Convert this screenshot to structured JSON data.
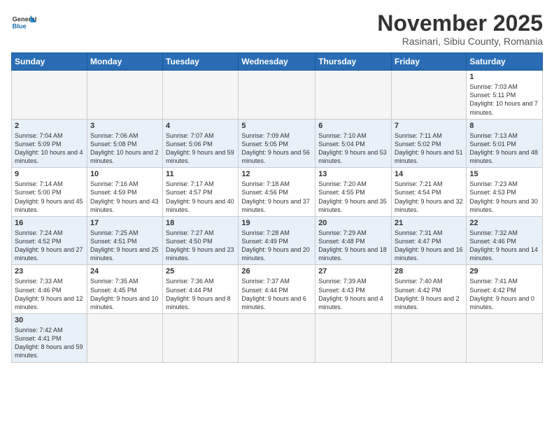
{
  "header": {
    "logo_general": "General",
    "logo_blue": "Blue",
    "month_title": "November 2025",
    "subtitle": "Rasinari, Sibiu County, Romania"
  },
  "days_of_week": [
    "Sunday",
    "Monday",
    "Tuesday",
    "Wednesday",
    "Thursday",
    "Friday",
    "Saturday"
  ],
  "weeks": [
    {
      "days": [
        {
          "num": "",
          "info": ""
        },
        {
          "num": "",
          "info": ""
        },
        {
          "num": "",
          "info": ""
        },
        {
          "num": "",
          "info": ""
        },
        {
          "num": "",
          "info": ""
        },
        {
          "num": "",
          "info": ""
        },
        {
          "num": "1",
          "info": "Sunrise: 7:03 AM\nSunset: 5:11 PM\nDaylight: 10 hours and 7 minutes."
        }
      ]
    },
    {
      "days": [
        {
          "num": "2",
          "info": "Sunrise: 7:04 AM\nSunset: 5:09 PM\nDaylight: 10 hours and 4 minutes."
        },
        {
          "num": "3",
          "info": "Sunrise: 7:06 AM\nSunset: 5:08 PM\nDaylight: 10 hours and 2 minutes."
        },
        {
          "num": "4",
          "info": "Sunrise: 7:07 AM\nSunset: 5:06 PM\nDaylight: 9 hours and 59 minutes."
        },
        {
          "num": "5",
          "info": "Sunrise: 7:09 AM\nSunset: 5:05 PM\nDaylight: 9 hours and 56 minutes."
        },
        {
          "num": "6",
          "info": "Sunrise: 7:10 AM\nSunset: 5:04 PM\nDaylight: 9 hours and 53 minutes."
        },
        {
          "num": "7",
          "info": "Sunrise: 7:11 AM\nSunset: 5:02 PM\nDaylight: 9 hours and 51 minutes."
        },
        {
          "num": "8",
          "info": "Sunrise: 7:13 AM\nSunset: 5:01 PM\nDaylight: 9 hours and 48 minutes."
        }
      ]
    },
    {
      "days": [
        {
          "num": "9",
          "info": "Sunrise: 7:14 AM\nSunset: 5:00 PM\nDaylight: 9 hours and 45 minutes."
        },
        {
          "num": "10",
          "info": "Sunrise: 7:16 AM\nSunset: 4:59 PM\nDaylight: 9 hours and 43 minutes."
        },
        {
          "num": "11",
          "info": "Sunrise: 7:17 AM\nSunset: 4:57 PM\nDaylight: 9 hours and 40 minutes."
        },
        {
          "num": "12",
          "info": "Sunrise: 7:18 AM\nSunset: 4:56 PM\nDaylight: 9 hours and 37 minutes."
        },
        {
          "num": "13",
          "info": "Sunrise: 7:20 AM\nSunset: 4:55 PM\nDaylight: 9 hours and 35 minutes."
        },
        {
          "num": "14",
          "info": "Sunrise: 7:21 AM\nSunset: 4:54 PM\nDaylight: 9 hours and 32 minutes."
        },
        {
          "num": "15",
          "info": "Sunrise: 7:23 AM\nSunset: 4:53 PM\nDaylight: 9 hours and 30 minutes."
        }
      ]
    },
    {
      "days": [
        {
          "num": "16",
          "info": "Sunrise: 7:24 AM\nSunset: 4:52 PM\nDaylight: 9 hours and 27 minutes."
        },
        {
          "num": "17",
          "info": "Sunrise: 7:25 AM\nSunset: 4:51 PM\nDaylight: 9 hours and 25 minutes."
        },
        {
          "num": "18",
          "info": "Sunrise: 7:27 AM\nSunset: 4:50 PM\nDaylight: 9 hours and 23 minutes."
        },
        {
          "num": "19",
          "info": "Sunrise: 7:28 AM\nSunset: 4:49 PM\nDaylight: 9 hours and 20 minutes."
        },
        {
          "num": "20",
          "info": "Sunrise: 7:29 AM\nSunset: 4:48 PM\nDaylight: 9 hours and 18 minutes."
        },
        {
          "num": "21",
          "info": "Sunrise: 7:31 AM\nSunset: 4:47 PM\nDaylight: 9 hours and 16 minutes."
        },
        {
          "num": "22",
          "info": "Sunrise: 7:32 AM\nSunset: 4:46 PM\nDaylight: 9 hours and 14 minutes."
        }
      ]
    },
    {
      "days": [
        {
          "num": "23",
          "info": "Sunrise: 7:33 AM\nSunset: 4:46 PM\nDaylight: 9 hours and 12 minutes."
        },
        {
          "num": "24",
          "info": "Sunrise: 7:35 AM\nSunset: 4:45 PM\nDaylight: 9 hours and 10 minutes."
        },
        {
          "num": "25",
          "info": "Sunrise: 7:36 AM\nSunset: 4:44 PM\nDaylight: 9 hours and 8 minutes."
        },
        {
          "num": "26",
          "info": "Sunrise: 7:37 AM\nSunset: 4:44 PM\nDaylight: 9 hours and 6 minutes."
        },
        {
          "num": "27",
          "info": "Sunrise: 7:39 AM\nSunset: 4:43 PM\nDaylight: 9 hours and 4 minutes."
        },
        {
          "num": "28",
          "info": "Sunrise: 7:40 AM\nSunset: 4:42 PM\nDaylight: 9 hours and 2 minutes."
        },
        {
          "num": "29",
          "info": "Sunrise: 7:41 AM\nSunset: 4:42 PM\nDaylight: 9 hours and 0 minutes."
        }
      ]
    },
    {
      "days": [
        {
          "num": "30",
          "info": "Sunrise: 7:42 AM\nSunset: 4:41 PM\nDaylight: 8 hours and 59 minutes."
        },
        {
          "num": "",
          "info": ""
        },
        {
          "num": "",
          "info": ""
        },
        {
          "num": "",
          "info": ""
        },
        {
          "num": "",
          "info": ""
        },
        {
          "num": "",
          "info": ""
        },
        {
          "num": "",
          "info": ""
        }
      ]
    }
  ]
}
